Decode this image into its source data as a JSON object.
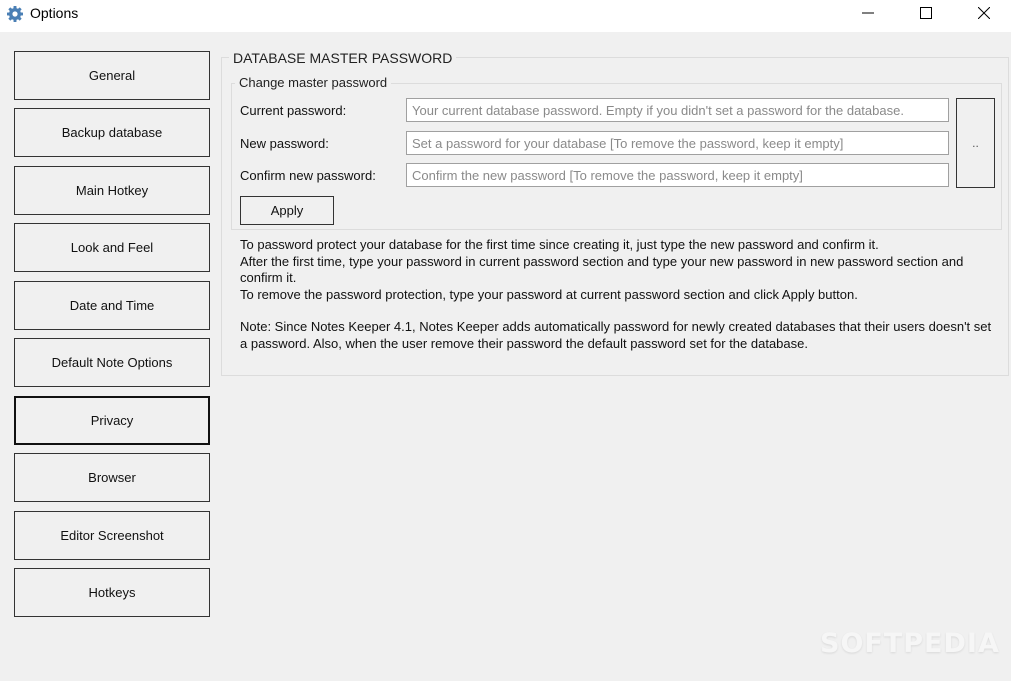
{
  "window": {
    "title": "Options",
    "app_icon": "gear-icon",
    "controls": {
      "minimize": "minimize-icon",
      "maximize": "maximize-icon",
      "close": "close-icon"
    }
  },
  "sidebar": {
    "selected": "Privacy",
    "items": [
      {
        "label": "General"
      },
      {
        "label": "Backup database"
      },
      {
        "label": "Main Hotkey"
      },
      {
        "label": "Look and Feel"
      },
      {
        "label": "Date and Time"
      },
      {
        "label": "Default Note Options"
      },
      {
        "label": "Privacy"
      },
      {
        "label": "Browser"
      },
      {
        "label": "Editor Screenshot"
      },
      {
        "label": "Hotkeys"
      }
    ]
  },
  "main": {
    "section_title": "DATABASE MASTER PASSWORD",
    "group_title": "Change master password",
    "fields": [
      {
        "label": "Current password:",
        "value": "",
        "placeholder": "Your current database password. Empty if you didn't set a password for the database."
      },
      {
        "label": "New password:",
        "value": "",
        "placeholder": "Set a password for your database [To remove the password, keep it empty]"
      },
      {
        "label": "Confirm new password:",
        "value": "",
        "placeholder": "Confirm the new password [To remove the password, keep it empty]"
      }
    ],
    "side_button_label": "..",
    "apply_label": "Apply",
    "help": {
      "line1": "To password protect your database for the first time since creating it, just type the new password and confirm it.",
      "line2": "After the first time, type your password in current password section and type your new password in new password section and confirm it.",
      "line3": "To remove the password protection, type your password at current password section and click Apply button.",
      "note": "Note: Since Notes Keeper 4.1, Notes Keeper adds automatically password for newly created databases that their users doesn't set a password. Also, when the user remove their password the default password set for the database."
    }
  },
  "watermark": "SOFTPEDIA"
}
